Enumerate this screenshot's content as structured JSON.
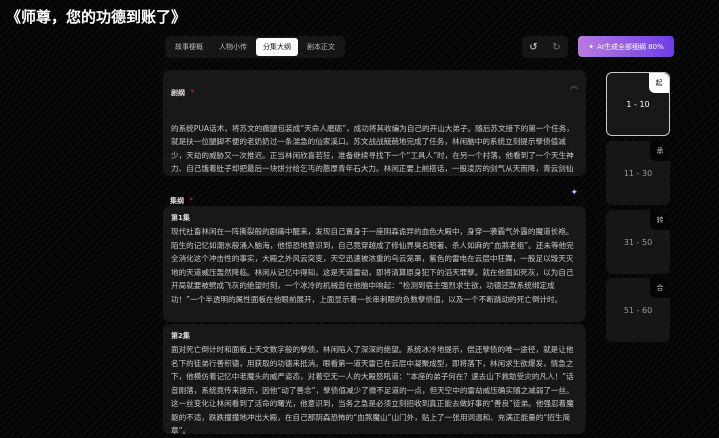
{
  "title": "《师尊，您的功德到账了》",
  "tabs": [
    "故事梗概",
    "人物小传",
    "分集大纲",
    "剧本正文"
  ],
  "toolbar": {
    "undo_icon": "↺",
    "redo_icon": "↻",
    "ai_label": "AI生成全部细纲 80%"
  },
  "outline": {
    "label": "剧纲",
    "text": "的系统PUA话术，将苏文的瘸腿包装成“天命人磨砺”，成功将其收编为自己的开山大弟子。随后苏文接下的第一个任务，就是扶一位腿脚不便的老奶奶过一条湍急的仙家溪口。苏文战战兢兢地完成了任务，林闲脑中的系统立刻提示孽债值减少，天劫的威胁又一次推迟。正当林闲欣喜若狂，准备继续寻找下一个“工具人”时，在另一个村落，他看到了一个天生神力、自己饿着肚子却把最后一块饼分给乞丐的憨厚青年石大力。林闲正要上前搭话，一股凌厉的剑气从天而降，青云剑仙手持仙剑，冷冷地悬浮在半空，直指林闲，厉声喝道：“妖魔，休要在此装神弄鬼，今日我便要替天行道！”"
  },
  "episodes": {
    "label": "集纲",
    "items": [
      {
        "title": "第1集",
        "text": "现代社畜林闲在一阵撕裂般的剧痛中醒来，发现自己置身于一座阴森诡异的血色大殿中，身穿一袭霸气外露的魔道长袍。陌生的记忆如潮水般涌入脑海，他惊恐地意识到，自己竟穿越成了修仙界臭名昭著、杀人如麻的“血煞老祖”。还未等他完全消化这个冲击性的事实，大殿之外风云突变，天空迅速被浓重的乌云笼罩，紫色的雷电在云层中狂舞，一股足以毁天灭地的天道威压轰然降临。林闲从记忆中得知，这是天道雷劫，即将清算原身犯下的滔天罪孽。就在他面如死灰，以为自己开局就要被劈成飞灰的绝望时刻，一个冰冷的机械音在他脑中响起：“检测到宿主强烈求生欲，功德还款系统绑定成功！”一个半透明的属性面板在他眼前展开，上面显示着一长串刺眼的负数孽债值，以及一个不断跳动的死亡倒计时。"
      },
      {
        "title": "第2集",
        "text": "面对死亡倒计时和面板上天文数字般的孽债，林闲陷入了深深的绝望。系统冰冷地提示，偿还孽债的唯一途径，就是让他名下的徒弟行善积德，用获取的功德来抵消。眼看第一道天雷已在云层中凝聚成型，即将落下，林闲求生欲爆发，情急之下，他模仿着记忆中老魔头的威严姿态，对着空无一人的大殿怒吼道：“本座的弟子何在？速去山下救助受灾的凡人！”话音刚落，系统竟传来提示，因他“动了善念”，孽债值减少了微不足道的一点，但天空中的雷劫威压确实随之减弱了一丝。这一丝变化让林闲看到了活命的曙光，他意识到，当务之急是必须立刻招收到真正能去做好事的“善良”徒弟。他强忍着魔躯的不适，跌跌撞撞地冲出大殿，在自己那阴森恐怖的“血煞魔山”山门外，贴上了一张用词温和、充满正能量的“招生简章”。"
      }
    ]
  },
  "acts": [
    {
      "tag": "起",
      "range": "1 - 10"
    },
    {
      "tag": "承",
      "range": "11 - 30"
    },
    {
      "tag": "转",
      "range": "31 - 50"
    },
    {
      "tag": "合",
      "range": "51 - 60"
    }
  ]
}
